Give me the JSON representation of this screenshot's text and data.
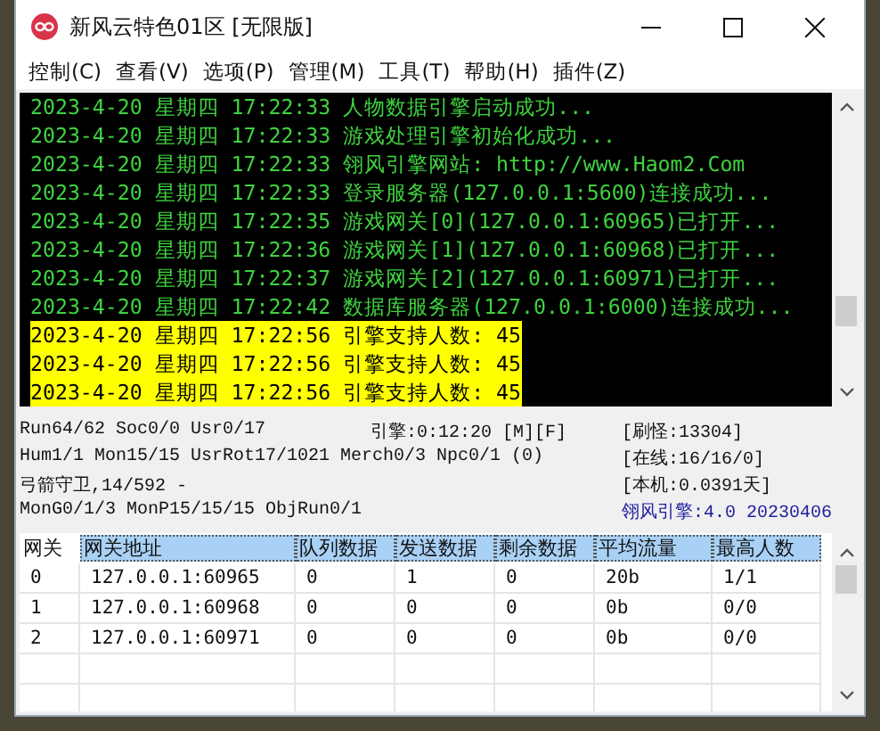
{
  "window": {
    "title": "新风云特色01区 [无限版]"
  },
  "menu": [
    "控制(C)",
    "查看(V)",
    "选项(P)",
    "管理(M)",
    "工具(T)",
    "帮助(H)",
    "插件(Z)"
  ],
  "log": [
    {
      "text": "2023-4-20 星期四 17:22:33 人物数据引擎启动成功...",
      "highlighted": false
    },
    {
      "text": "2023-4-20 星期四 17:22:33 游戏处理引擎初始化成功...",
      "highlighted": false
    },
    {
      "text": "2023-4-20 星期四 17:22:33 翎风引擎网站: http://www.Haom2.Com",
      "highlighted": false
    },
    {
      "text": "2023-4-20 星期四 17:22:33 登录服务器(127.0.0.1:5600)连接成功...",
      "highlighted": false
    },
    {
      "text": "2023-4-20 星期四 17:22:35 游戏网关[0](127.0.0.1:60965)已打开...",
      "highlighted": false
    },
    {
      "text": "2023-4-20 星期四 17:22:36 游戏网关[1](127.0.0.1:60968)已打开...",
      "highlighted": false
    },
    {
      "text": "2023-4-20 星期四 17:22:37 游戏网关[2](127.0.0.1:60971)已打开...",
      "highlighted": false
    },
    {
      "text": "2023-4-20 星期四 17:22:42 数据库服务器(127.0.0.1:6000)连接成功...",
      "highlighted": false
    },
    {
      "text": "2023-4-20 星期四 17:22:56 引擎支持人数: 45",
      "highlighted": true
    },
    {
      "text": "2023-4-20 星期四 17:22:56 引擎支持人数: 45",
      "highlighted": true
    },
    {
      "text": "2023-4-20 星期四 17:22:56 引擎支持人数: 45",
      "highlighted": true
    }
  ],
  "status": {
    "left": [
      "Run64/62 Soc0/0 Usr0/17",
      "Hum1/1 Mon15/15 UsrRot17/1021 Merch0/3 Npc0/1 (0)",
      "弓箭守卫,14/592 -",
      "MonG0/1/3 MonP15/15/15 ObjRun0/1"
    ],
    "uptime": "引擎:0:12:20 [M][F]",
    "right": [
      "[刷怪:13304]",
      "[在线:16/16/0]",
      "[本机:0.0391天]"
    ],
    "version": "翎风引擎:4.0 20230406"
  },
  "gateway_table": {
    "columns": [
      {
        "label": "网关",
        "selected": false
      },
      {
        "label": "网关地址",
        "selected": true
      },
      {
        "label": "队列数据",
        "selected": true
      },
      {
        "label": "发送数据",
        "selected": true
      },
      {
        "label": "剩余数据",
        "selected": true
      },
      {
        "label": "平均流量",
        "selected": true
      },
      {
        "label": "最高人数",
        "selected": true
      }
    ],
    "rows": [
      [
        "0",
        "127.0.0.1:60965",
        "0",
        "1",
        "0",
        "20b",
        "1/1"
      ],
      [
        "1",
        "127.0.0.1:60968",
        "0",
        "0",
        "0",
        "0b",
        "0/0"
      ],
      [
        "2",
        "127.0.0.1:60971",
        "0",
        "0",
        "0",
        "0b",
        "0/0"
      ]
    ]
  }
}
